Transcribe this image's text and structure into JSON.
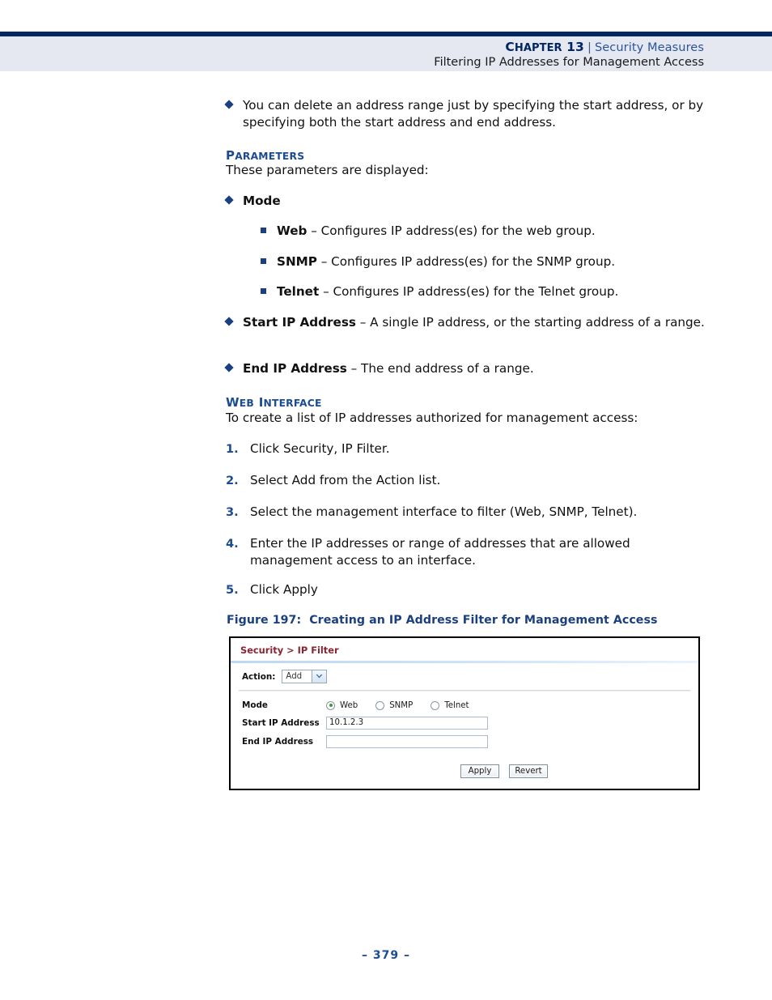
{
  "header": {
    "chapter_label": "Chapter",
    "chapter_number": "13",
    "separator": "|",
    "chapter_title": "Security Measures",
    "section_title": "Filtering IP Addresses for Management Access"
  },
  "body": {
    "intro_bullet": "You can delete an address range just by specifying the start address, or by specifying both the start address and end address.",
    "parameters_heading": "Parameters",
    "parameters_intro": "These parameters are displayed:",
    "mode_label": "Mode",
    "mode_options": [
      {
        "term": "Web",
        "dash": "–",
        "description": "Configures IP address(es) for the web group."
      },
      {
        "term": "SNMP",
        "dash": "–",
        "description": "Configures IP address(es) for the SNMP group."
      },
      {
        "term": "Telnet",
        "dash": "–",
        "description": "Configures IP address(es) for the Telnet group."
      }
    ],
    "params": [
      {
        "term": "Start IP Address",
        "dash": "–",
        "description": "A single IP address, or the starting address of a range."
      },
      {
        "term": "End IP Address",
        "dash": "–",
        "description": "The end address of a range."
      }
    ],
    "web_interface_heading": "Web Interface",
    "web_interface_intro": "To create a list of IP addresses authorized for management access:",
    "steps": [
      {
        "number": "1.",
        "text": "Click Security, IP Filter."
      },
      {
        "number": "2.",
        "text": "Select Add from the Action list."
      },
      {
        "number": "3.",
        "text": "Select the management interface to filter (Web, SNMP, Telnet)."
      },
      {
        "number": "4.",
        "text": "Enter the IP addresses or range of addresses that are allowed management access to an interface."
      },
      {
        "number": "5.",
        "text": "Click Apply"
      }
    ]
  },
  "figure": {
    "caption_label": "Figure 197:",
    "caption_text": "Creating an IP Address Filter for Management Access",
    "ui": {
      "breadcrumb": "Security > IP Filter",
      "action_label": "Action:",
      "action_value": "Add",
      "mode_label": "Mode",
      "radios": [
        {
          "label": "Web",
          "selected": true
        },
        {
          "label": "SNMP",
          "selected": false
        },
        {
          "label": "Telnet",
          "selected": false
        }
      ],
      "start_ip_label": "Start IP Address",
      "start_ip_value": "10.1.2.3",
      "end_ip_label": "End IP Address",
      "end_ip_value": "",
      "apply_label": "Apply",
      "revert_label": "Revert"
    }
  },
  "footer": {
    "page_number": "–  379  –"
  },
  "colors": {
    "navy": "#002663",
    "heading_blue": "#1b4b91",
    "link_blue": "#2b5596",
    "header_band": "#e5e8f1",
    "ui_title_red": "#8a2431",
    "radio_green": "#3a9b2f"
  }
}
